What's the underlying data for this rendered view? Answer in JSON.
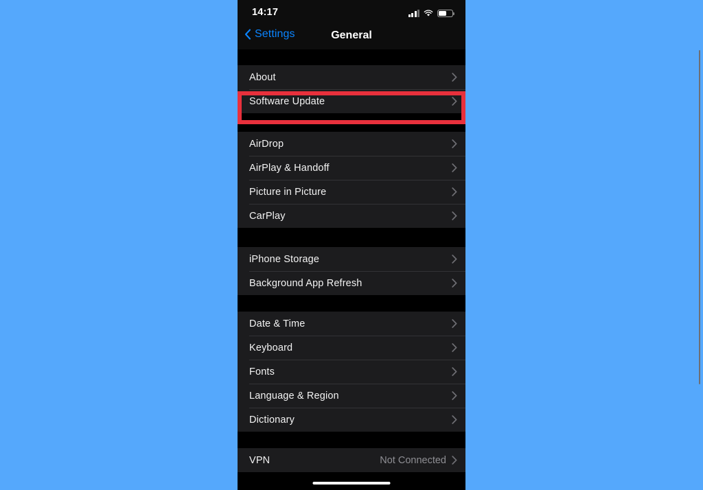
{
  "background_color": "#55a8fc",
  "phone": {
    "screen_bg": "#000000",
    "group_bg": "#1c1c1e",
    "status_bar": {
      "time": "14:17",
      "cellular_icon": "cellular-signal-icon",
      "wifi_icon": "wifi-icon",
      "battery_icon": "battery-icon"
    },
    "nav_bar": {
      "back_icon": "chevron-left-icon",
      "back_label": "Settings",
      "title": "General",
      "accent_color": "#0a84ff"
    },
    "home_indicator": "home-indicator"
  },
  "highlight": {
    "color": "#e8303c",
    "target_label": "Software Update"
  },
  "sections": [
    {
      "id": "system-info",
      "rows": [
        {
          "name": "about",
          "label": "About",
          "value": "",
          "accessory": "chevron-right-icon"
        },
        {
          "name": "software-update",
          "label": "Software Update",
          "value": "",
          "accessory": "chevron-right-icon"
        }
      ]
    },
    {
      "id": "connectivity",
      "rows": [
        {
          "name": "airdrop",
          "label": "AirDrop",
          "value": "",
          "accessory": "chevron-right-icon"
        },
        {
          "name": "airplay-handoff",
          "label": "AirPlay & Handoff",
          "value": "",
          "accessory": "chevron-right-icon"
        },
        {
          "name": "picture-in-picture",
          "label": "Picture in Picture",
          "value": "",
          "accessory": "chevron-right-icon"
        },
        {
          "name": "carplay",
          "label": "CarPlay",
          "value": "",
          "accessory": "chevron-right-icon"
        }
      ]
    },
    {
      "id": "storage",
      "rows": [
        {
          "name": "iphone-storage",
          "label": "iPhone Storage",
          "value": "",
          "accessory": "chevron-right-icon"
        },
        {
          "name": "background-app-refresh",
          "label": "Background App Refresh",
          "value": "",
          "accessory": "chevron-right-icon"
        }
      ]
    },
    {
      "id": "localization",
      "rows": [
        {
          "name": "date-time",
          "label": "Date & Time",
          "value": "",
          "accessory": "chevron-right-icon"
        },
        {
          "name": "keyboard",
          "label": "Keyboard",
          "value": "",
          "accessory": "chevron-right-icon"
        },
        {
          "name": "fonts",
          "label": "Fonts",
          "value": "",
          "accessory": "chevron-right-icon"
        },
        {
          "name": "language-region",
          "label": "Language & Region",
          "value": "",
          "accessory": "chevron-right-icon"
        },
        {
          "name": "dictionary",
          "label": "Dictionary",
          "value": "",
          "accessory": "chevron-right-icon"
        }
      ]
    },
    {
      "id": "network",
      "rows": [
        {
          "name": "vpn",
          "label": "VPN",
          "value": "Not Connected",
          "accessory": "chevron-right-icon"
        }
      ]
    }
  ]
}
